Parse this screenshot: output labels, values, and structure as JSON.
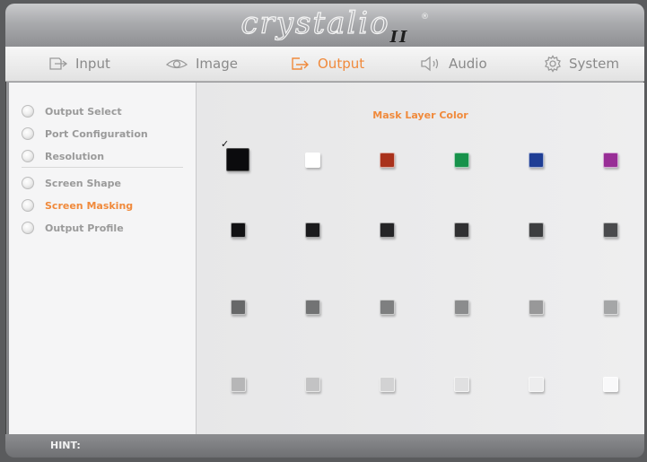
{
  "brand": {
    "logo_text": "crystalio",
    "logo_version": "II",
    "registered_mark": "®"
  },
  "tabs": [
    {
      "label": "Input",
      "icon": "input-icon",
      "active": false
    },
    {
      "label": "Image",
      "icon": "eye-icon",
      "active": false
    },
    {
      "label": "Output",
      "icon": "output-icon",
      "active": true
    },
    {
      "label": "Audio",
      "icon": "speaker-icon",
      "active": false
    },
    {
      "label": "System",
      "icon": "gear-icon",
      "active": false
    }
  ],
  "sidebar": {
    "items": [
      {
        "label": "Output Select",
        "active": false
      },
      {
        "label": "Port Configuration",
        "active": false
      },
      {
        "label": "Resolution",
        "active": false
      },
      {
        "label": "Screen Shape",
        "active": false
      },
      {
        "label": "Screen Masking",
        "active": true
      },
      {
        "label": "Output Profile",
        "active": false
      }
    ]
  },
  "main": {
    "title": "Mask Layer Color",
    "selected_check": "✓",
    "swatches": [
      [
        "#0b0b0d",
        "#ffffff",
        "#a9321c",
        "#17924b",
        "#1f3e95",
        "#982e96"
      ],
      [
        "#121214",
        "#1b1b1d",
        "#252527",
        "#303032",
        "#3d3e40",
        "#4a4b4d"
      ],
      [
        "#676869",
        "#727374",
        "#7e7f80",
        "#8b8c8d",
        "#989899",
        "#a5a6a7"
      ],
      [
        "#b6b6b7",
        "#c3c3c4",
        "#d2d2d3",
        "#e0e0e1",
        "#ededee",
        "#f9f9fa"
      ]
    ]
  },
  "hint": {
    "label": "HINT:"
  },
  "colors": {
    "accent": "#f08a3c",
    "inactive_text": "#8a8a8a"
  }
}
